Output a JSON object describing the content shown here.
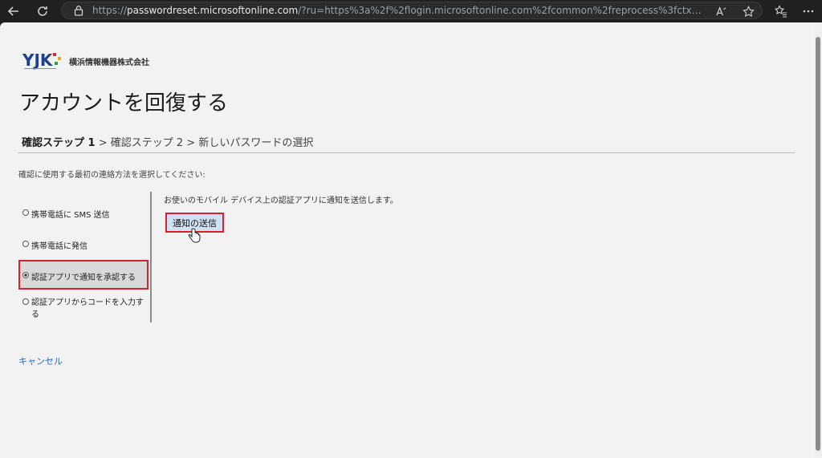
{
  "browser": {
    "url_prefix": "https://",
    "url_host": "passwordreset.microsoftonline.com",
    "url_rest": "/?ru=https%3a%2f%2flogin.microsoftonline.com%2fcommon%2freprocess%3fctx%3drQQIARAAhZI7jONkFI..."
  },
  "logo": {
    "mark_text": "YJK",
    "company_name": "横浜情報機器株式会社"
  },
  "page": {
    "title": "アカウントを回復する",
    "steps": {
      "current": "確認ステップ 1",
      "sep1": " > ",
      "step2": "確認ステップ 2",
      "sep2": " > ",
      "step3": "新しいパスワードの選択"
    },
    "instruction": "確認に使用する最初の連絡方法を選択してください:",
    "options": [
      {
        "label": "携帯電話に SMS 送信",
        "selected": false
      },
      {
        "label": "携帯電話に発信",
        "selected": false
      },
      {
        "label": "認証アプリで通知を承認する",
        "selected": true
      },
      {
        "label": "認証アプリからコードを入力する",
        "selected": false
      }
    ],
    "description": "お使いのモバイル デバイス上の認証アプリに通知を送信します。",
    "send_button": "通知の送信",
    "cancel_link": "キャンセル"
  },
  "colors": {
    "highlight_border": "#d62030",
    "button_bg": "#cfe1f3",
    "link": "#1a6fc4"
  }
}
